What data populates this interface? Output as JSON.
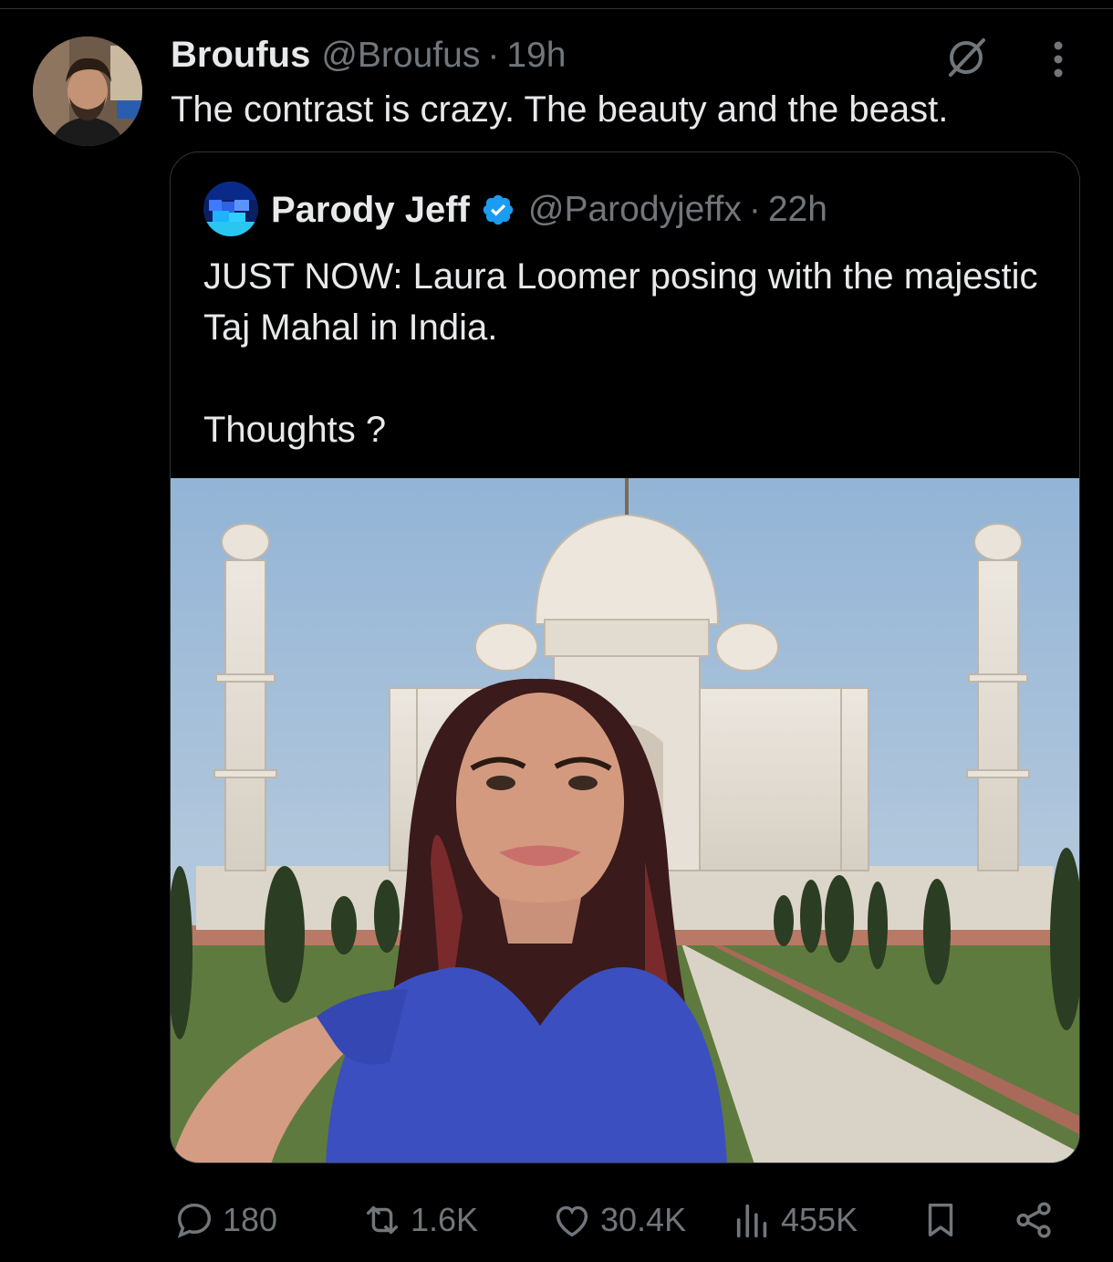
{
  "tweet": {
    "display_name": "Broufus",
    "handle": "@Broufus",
    "separator": "·",
    "time": "19h",
    "text": "The contrast is crazy. The beauty and the beast.",
    "avatar_icon": "profile-photo",
    "grok_icon": "grok-icon",
    "more_icon": "more-icon"
  },
  "quote": {
    "display_name": "Parody Jeff",
    "verified_icon": "verified-badge-icon",
    "verified_color": "#1d9bf0",
    "handle": "@Parodyjeffx",
    "separator": "·",
    "time": "22h",
    "text": "JUST NOW: Laura Loomer posing with the majestic Taj Mahal in India.\n\nThoughts ?",
    "media_description": "Selfie photo in front of the Taj Mahal"
  },
  "actions": {
    "replies": "180",
    "reposts": "1.6K",
    "likes": "30.4K",
    "views": "455K"
  },
  "colors": {
    "background": "#000000",
    "text_primary": "#e7e9ea",
    "text_secondary": "#71767b",
    "border": "#2f3336"
  }
}
